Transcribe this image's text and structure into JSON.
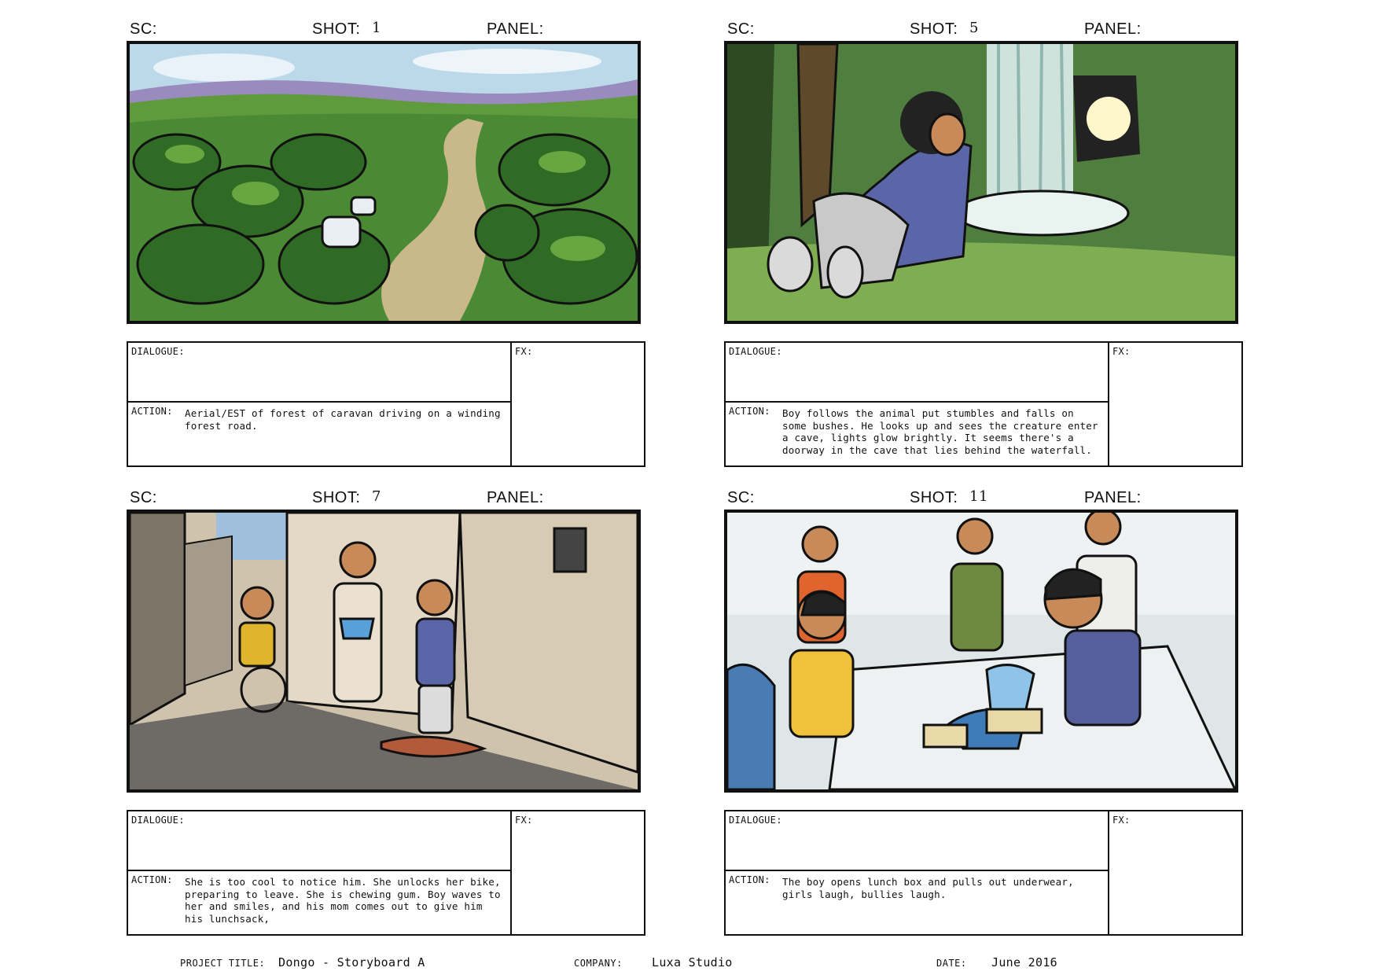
{
  "labels": {
    "sc": "SC:",
    "shot": "SHOT:",
    "panel": "PANEL:",
    "dialogue": "DIALOGUE:",
    "action": "ACTION:",
    "fx": "FX:"
  },
  "shots": [
    {
      "number": "1",
      "image": "forest-caravan-road-illustration",
      "action": "Aerial/EST of forest of caravan driving on a winding forest road."
    },
    {
      "number": "5",
      "image": "boy-at-waterfall-cave-illustration",
      "action": "Boy follows the animal put stumbles and falls on some bushes. He looks up and sees the creature enter a cave, lights glow brightly. It seems there's a doorway in the cave that lies behind the waterfall."
    },
    {
      "number": "7",
      "image": "girl-on-bike-street-illustration",
      "action": "She is too cool to notice him. She unlocks her bike, preparing to leave. She is chewing gum. Boy waves to her and smiles, and his mom comes out to give him his lunchsack,"
    },
    {
      "number": "11",
      "image": "lunch-table-bullies-illustration",
      "action": "The boy opens lunch box and pulls out underwear, girls laugh, bullies laugh."
    }
  ],
  "footer": {
    "project_label": "PROJECT TITLE:",
    "project_value": "Dongo - Storyboard A",
    "company_label": "COMPANY:",
    "company_value": "Luxa Studio",
    "date_label": "DATE:",
    "date_value": "June 2016"
  }
}
